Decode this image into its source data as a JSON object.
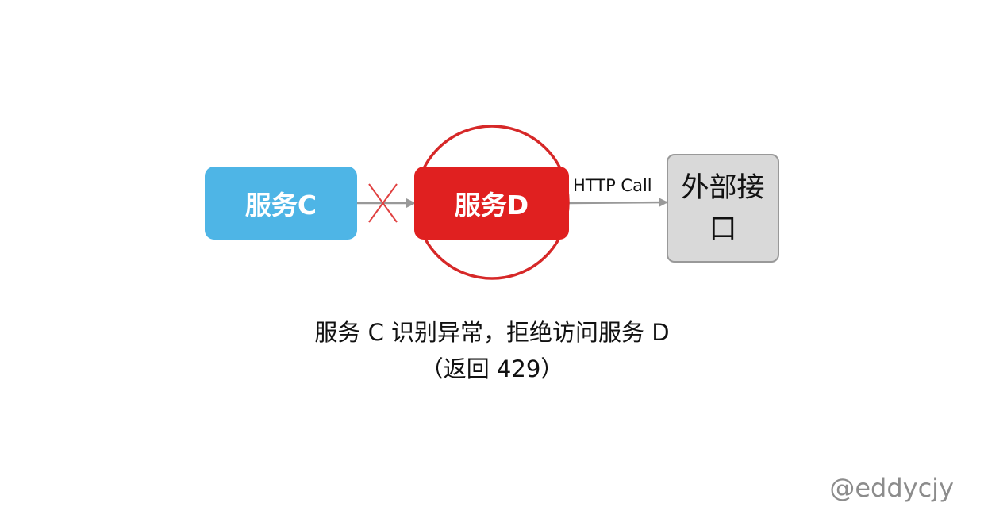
{
  "nodes": {
    "service_c": "服务C",
    "service_d": "服务D",
    "external_api": "外部接口"
  },
  "edges": {
    "d_to_external_label": "HTTP Call"
  },
  "caption": {
    "line1": "服务 C 识别异常，拒绝访问服务 D",
    "line2": "（返回 429）"
  },
  "watermark": "@eddycjy",
  "colors": {
    "service_c_fill": "#4eb5e6",
    "service_d_fill": "#e02020",
    "highlight_ring": "#d62828",
    "blocked_cross": "#e04040",
    "external_fill": "#d9d9d9",
    "external_border": "#999999",
    "arrow": "#999999"
  },
  "icons": {
    "blocked_marker": "cross-icon"
  }
}
